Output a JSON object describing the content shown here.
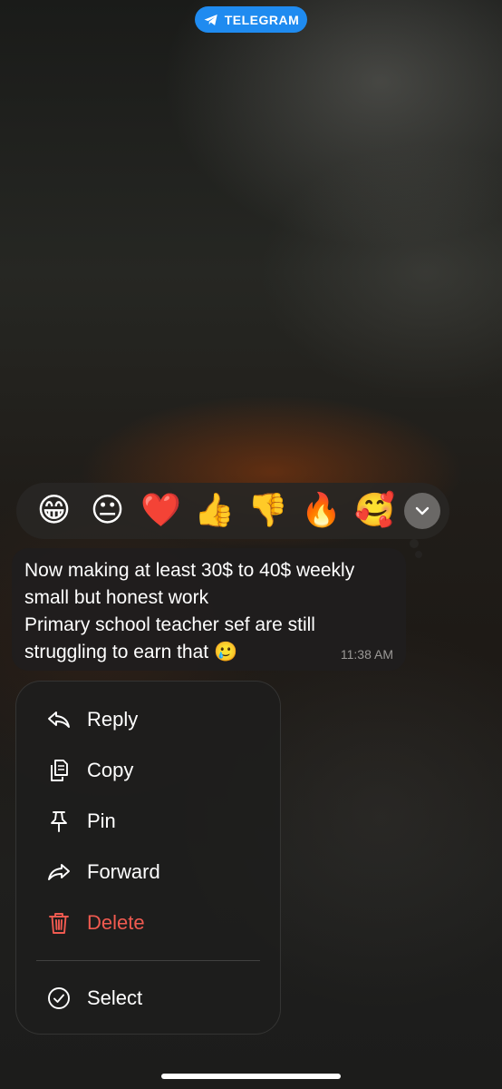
{
  "header": {
    "app_badge": "TELEGRAM"
  },
  "reactions": [
    {
      "name": "grinning-face",
      "glyph": "😁"
    },
    {
      "name": "neutral-face",
      "glyph": "😐"
    },
    {
      "name": "red-heart",
      "glyph": "❤️"
    },
    {
      "name": "thumbs-up",
      "glyph": "👍"
    },
    {
      "name": "thumbs-down",
      "glyph": "👎"
    },
    {
      "name": "fire",
      "glyph": "🔥"
    },
    {
      "name": "smiling-face-with-hearts",
      "glyph": "🥰"
    }
  ],
  "message": {
    "lines": [
      "Now making at least 30$ to 40$ weekly",
      "small but honest work",
      "Primary school teacher sef are still",
      "struggling to earn that 🥲"
    ],
    "time": "11:38 AM"
  },
  "menu": {
    "reply": "Reply",
    "copy": "Copy",
    "pin": "Pin",
    "forward": "Forward",
    "delete": "Delete",
    "select": "Select"
  },
  "colors": {
    "telegram_blue": "#1f8bf0",
    "danger": "#f05a50"
  }
}
